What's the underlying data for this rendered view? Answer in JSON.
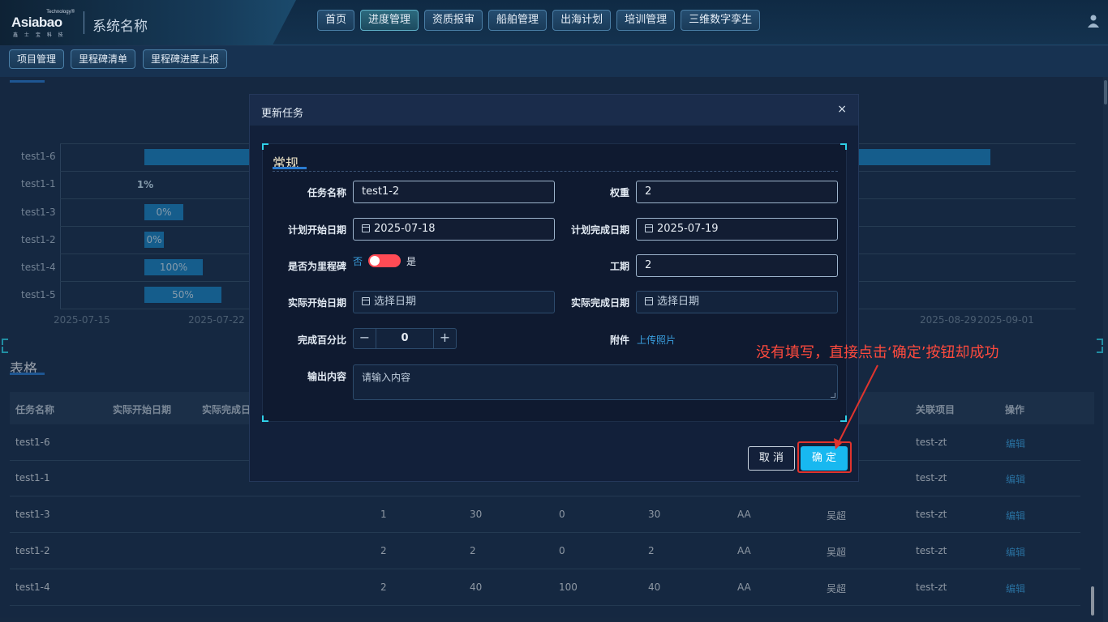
{
  "header": {
    "logo_tech": "Technology®",
    "logo_brand": "Asiabao",
    "logo_sub": "鑫 士 宝 科 技",
    "system_name": "系统名称",
    "nav": [
      {
        "label": "首页"
      },
      {
        "label": "进度管理",
        "active": true
      },
      {
        "label": "资质报审"
      },
      {
        "label": "船舶管理"
      },
      {
        "label": "出海计划"
      },
      {
        "label": "培训管理"
      },
      {
        "label": "三维数字孪生"
      }
    ]
  },
  "subnav": [
    {
      "label": "项目管理"
    },
    {
      "label": "里程碑清单"
    },
    {
      "label": "里程碑进度上报"
    }
  ],
  "gantt": {
    "rows": [
      {
        "label": "test1-6",
        "value": ""
      },
      {
        "label": "test1-1",
        "value": "1%"
      },
      {
        "label": "test1-3",
        "value": "0%"
      },
      {
        "label": "test1-2",
        "value": "0%"
      },
      {
        "label": "test1-4",
        "value": "100%"
      },
      {
        "label": "test1-5",
        "value": "50%"
      }
    ],
    "dates": [
      "2025-07-15",
      "2025-07-22",
      "2025-08-29",
      "2025-09-01"
    ]
  },
  "table": {
    "title": "表格",
    "headers": {
      "name": "任务名称",
      "actual_start": "实际开始日期",
      "actual_end": "实际完成日",
      "project": "关联项目",
      "ops": "操作"
    },
    "rows": [
      {
        "name": "test1-6",
        "c1": "",
        "c2": "",
        "c3": "",
        "c4": "",
        "c5": "",
        "person": "",
        "project": "test-zt",
        "op": "编辑"
      },
      {
        "name": "test1-1",
        "c1": "",
        "c2": "",
        "c3": "",
        "c4": "",
        "c5": "",
        "person": "",
        "project": "test-zt",
        "op": "编辑"
      },
      {
        "name": "test1-3",
        "c1": "1",
        "c2": "30",
        "c3": "0",
        "c4": "30",
        "c5": "AA",
        "person": "吴超",
        "project": "test-zt",
        "op": "编辑"
      },
      {
        "name": "test1-2",
        "c1": "2",
        "c2": "2",
        "c3": "0",
        "c4": "2",
        "c5": "AA",
        "person": "吴超",
        "project": "test-zt",
        "op": "编辑"
      },
      {
        "name": "test1-4",
        "c1": "2",
        "c2": "40",
        "c3": "100",
        "c4": "40",
        "c5": "AA",
        "person": "吴超",
        "project": "test-zt",
        "op": "编辑"
      }
    ]
  },
  "modal": {
    "title": "更新任务",
    "close": "×",
    "section": "常规",
    "fields": {
      "task_name_label": "任务名称",
      "task_name_value": "test1-2",
      "weight_label": "权重",
      "weight_value": "2",
      "plan_start_label": "计划开始日期",
      "plan_start_value": "2025-07-18",
      "plan_end_label": "计划完成日期",
      "plan_end_value": "2025-07-19",
      "milestone_label": "是否为里程碑",
      "milestone_no": "否",
      "milestone_yes": "是",
      "workdays_label": "工期",
      "workdays_value": "2",
      "actual_start_label": "实际开始日期",
      "actual_start_placeholder": "选择日期",
      "actual_end_label": "实际完成日期",
      "actual_end_placeholder": "选择日期",
      "percent_label": "完成百分比",
      "percent_value": "0",
      "attachment_label": "附件",
      "attachment_link": "上传照片",
      "output_label": "输出内容",
      "output_placeholder": "请输入内容"
    },
    "cancel": "取 消",
    "ok": "确 定"
  },
  "annotation": "没有填写，直接点击‘确定’按钮却成功",
  "colors": {
    "accent": "#18b8f0",
    "annotation": "#ff4a3d",
    "switch": "#ff4b55"
  }
}
